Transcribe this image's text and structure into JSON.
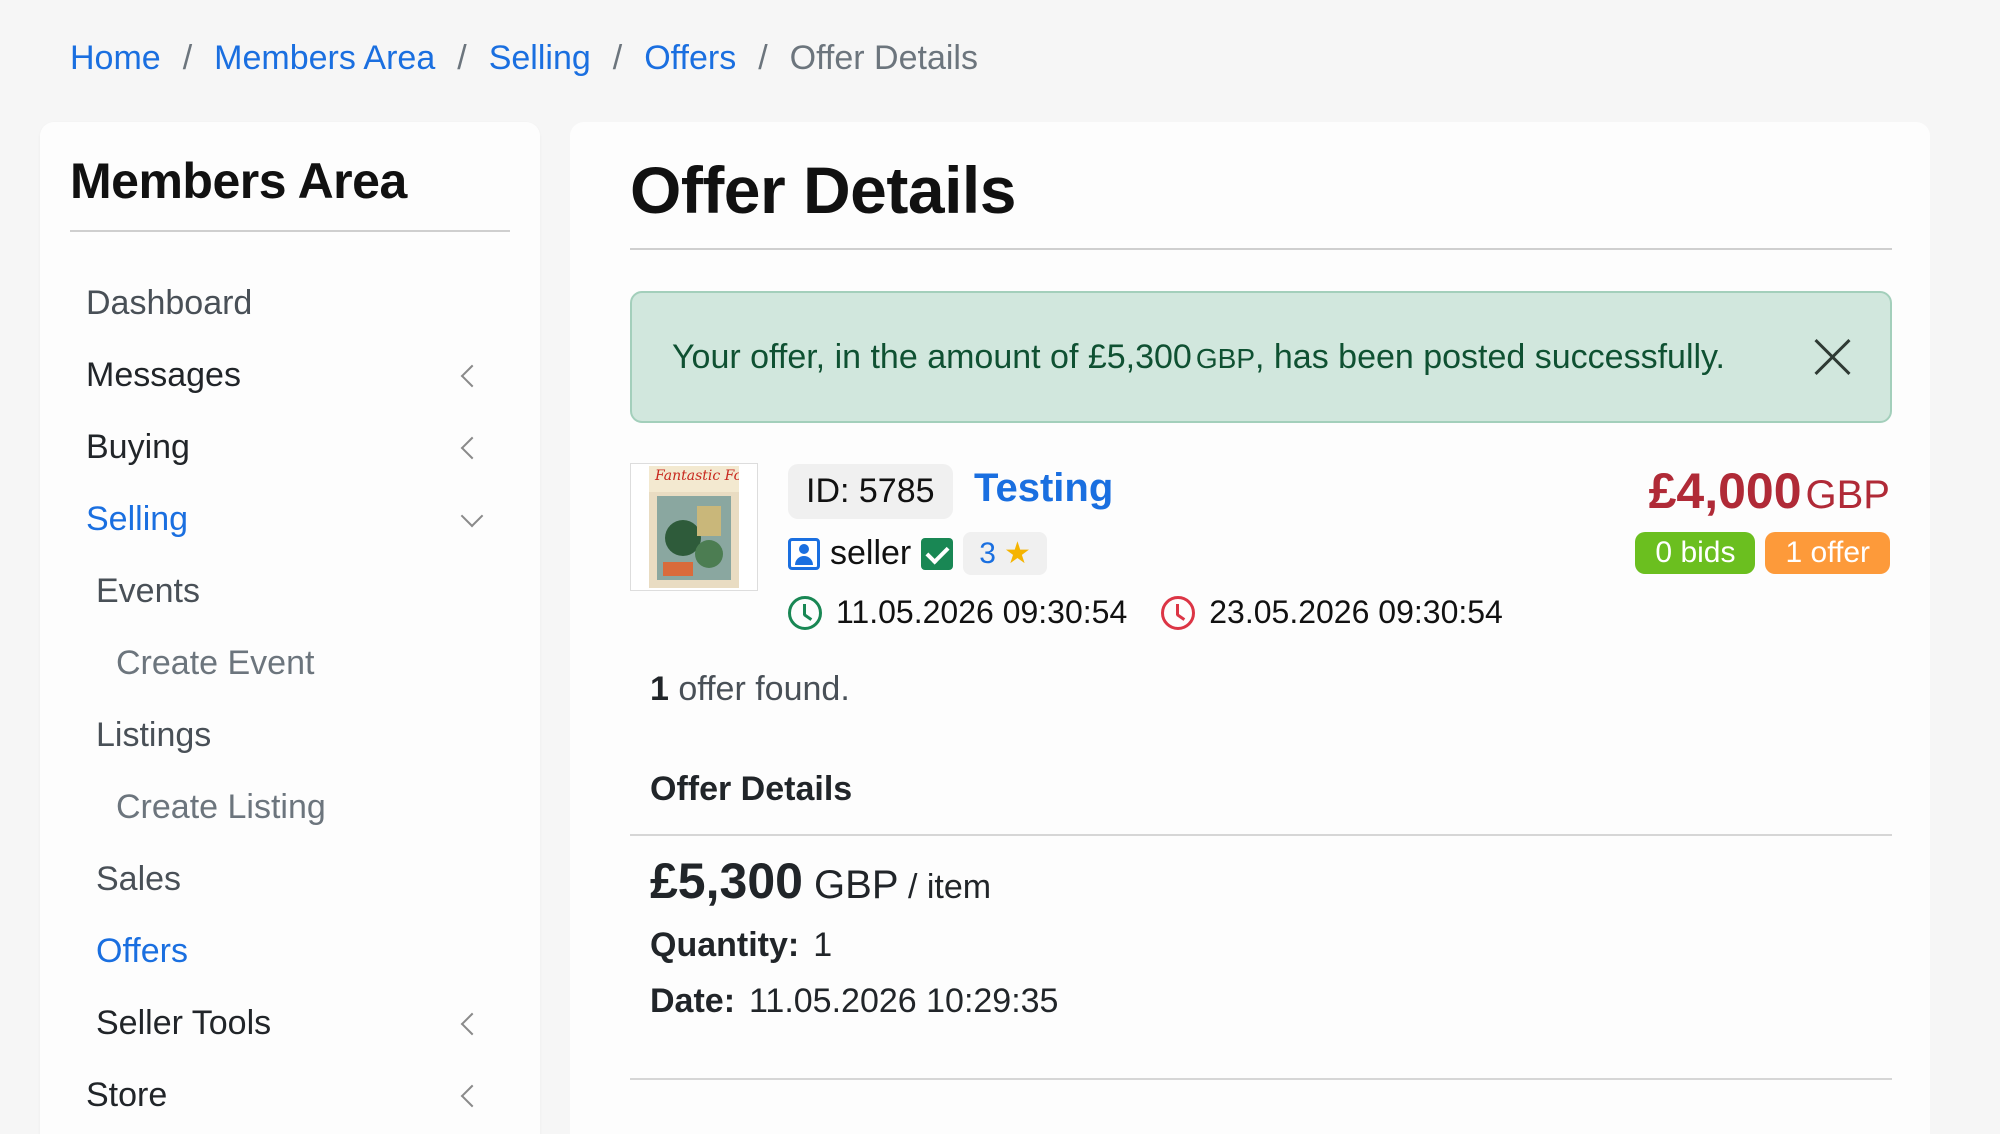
{
  "breadcrumb": {
    "items": [
      "Home",
      "Members Area",
      "Selling",
      "Offers"
    ],
    "current": "Offer Details",
    "separator": "/"
  },
  "sidebar": {
    "title": "Members Area",
    "items": [
      {
        "label": "Dashboard"
      },
      {
        "label": "Messages"
      },
      {
        "label": "Buying"
      },
      {
        "label": "Selling"
      },
      {
        "label": "Events"
      },
      {
        "label": "Create Event"
      },
      {
        "label": "Listings"
      },
      {
        "label": "Create Listing"
      },
      {
        "label": "Sales"
      },
      {
        "label": "Offers"
      },
      {
        "label": "Seller Tools"
      },
      {
        "label": "Store"
      }
    ]
  },
  "main": {
    "title": "Offer Details",
    "alert": {
      "text_before": "Your offer, in the amount of £5,300",
      "currency": "GBP",
      "text_after": ", has been posted successfully."
    },
    "listing": {
      "id_label": "ID: 5785",
      "title": "Testing",
      "seller": "seller",
      "rating": "3",
      "start_date": "11.05.2026 09:30:54",
      "end_date": "23.05.2026 09:30:54",
      "price": "£4,000",
      "price_currency": "GBP",
      "bids_badge": "0 bids",
      "offers_badge": "1 offer",
      "thumb_title": "Fantastic Four"
    },
    "found_count": "1",
    "found_text": " offer found.",
    "section_title": "Offer Details",
    "offer": {
      "amount": "£5,300",
      "currency": " GBP",
      "per": " / item",
      "quantity_label": "Quantity:",
      "quantity": "1",
      "date_label": "Date:",
      "date": "11.05.2026 10:29:35"
    }
  },
  "colors": {
    "link": "#1a6fe0",
    "alert_bg": "#d1e7dd",
    "price": "#b02a37",
    "bids_badge": "#6bbf1f",
    "offers_badge": "#fd9a3a"
  }
}
